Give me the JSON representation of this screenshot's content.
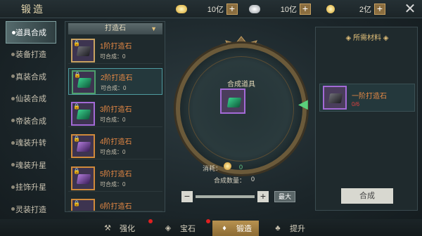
{
  "header": {
    "title": "锻造"
  },
  "resources": [
    {
      "icon": "gold-ingot-icon",
      "value": "10亿"
    },
    {
      "icon": "silver-ingot-icon",
      "value": "10亿"
    },
    {
      "icon": "coin-icon",
      "value": "2亿"
    }
  ],
  "sidebar": {
    "items": [
      {
        "label": "道具合成"
      },
      {
        "label": "装备打造"
      },
      {
        "label": "真装合成"
      },
      {
        "label": "仙装合成"
      },
      {
        "label": "帝装合成"
      },
      {
        "label": "魂装升转"
      },
      {
        "label": "魂装升星"
      },
      {
        "label": "挂饰升星"
      },
      {
        "label": "灵装打造"
      }
    ]
  },
  "list": {
    "dropdown": "打造石",
    "items": [
      {
        "name": "1阶打造石",
        "can": "可合成：0"
      },
      {
        "name": "2阶打造石",
        "can": "可合成：0"
      },
      {
        "name": "3阶打造石",
        "can": "可合成：0"
      },
      {
        "name": "4阶打造石",
        "can": "可合成：0"
      },
      {
        "name": "5阶打造石",
        "can": "可合成：0"
      },
      {
        "name": "6阶打造石",
        "can": ""
      }
    ]
  },
  "center": {
    "title": "合成道具",
    "cost_label": "消耗：",
    "cost_value": "0",
    "qty_label": "合成数量：",
    "qty_value": "0",
    "max_label": "最大"
  },
  "right": {
    "title": "◈ 所需材料 ◈",
    "material": "一阶打造石",
    "count": "0/6",
    "button": "合成"
  },
  "tabs": [
    {
      "label": "强化"
    },
    {
      "label": "宝石"
    },
    {
      "label": "锻造"
    },
    {
      "label": "提升"
    }
  ]
}
